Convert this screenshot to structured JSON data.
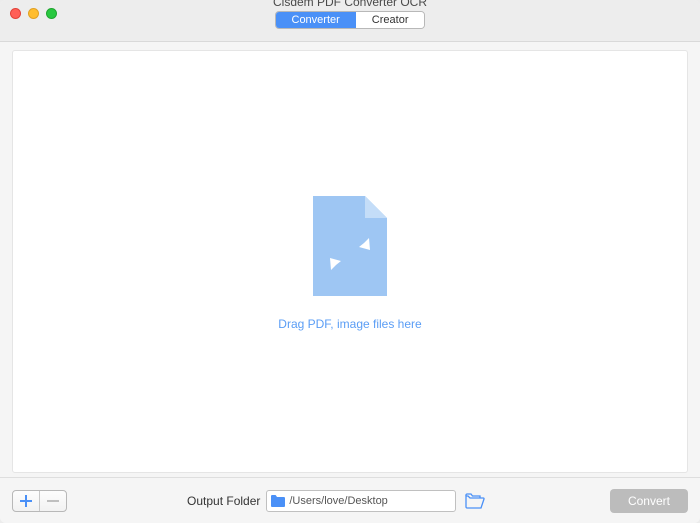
{
  "window": {
    "title": "Cisdem PDF Converter OCR"
  },
  "tabs": {
    "converter": "Converter",
    "creator": "Creator",
    "active": "converter"
  },
  "dropzone": {
    "hint": "Drag PDF, image files here"
  },
  "footer": {
    "output_label": "Output Folder",
    "output_path": "/Users/love/Desktop",
    "convert_label": "Convert"
  },
  "colors": {
    "accent": "#4a90f7",
    "icon_fill": "#9ec6f3"
  }
}
